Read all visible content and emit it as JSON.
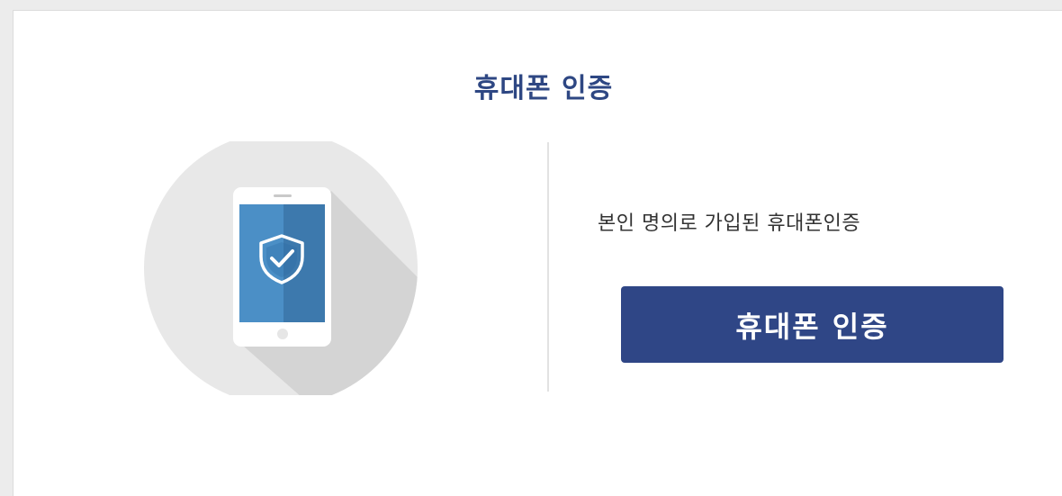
{
  "card": {
    "title": "휴대폰 인증",
    "description": "본인 명의로 가입된 휴대폰인증",
    "button_label": "휴대폰 인증"
  },
  "illustration": {
    "icon": "phone-shield-check-icon"
  },
  "colors": {
    "accent": "#2f4686",
    "title": "#2e4783",
    "circle": "#e8e8e8",
    "screen": "#4a8ec4"
  }
}
